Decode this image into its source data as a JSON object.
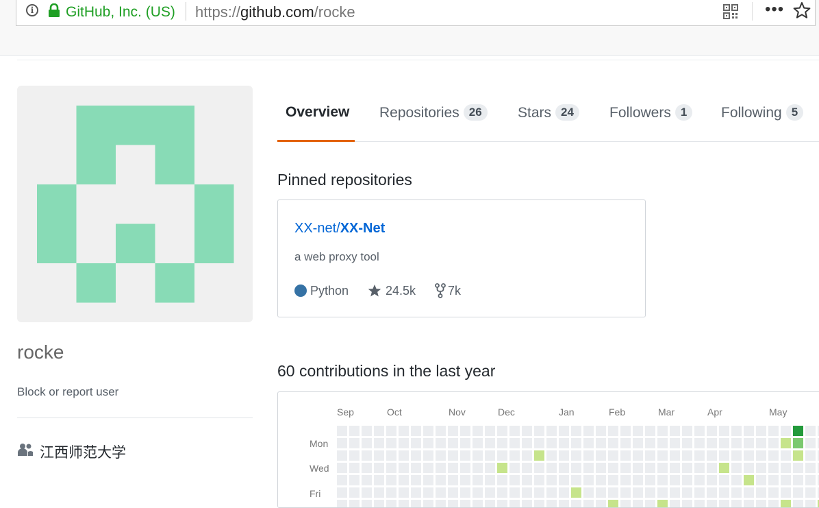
{
  "browser": {
    "site_identity": "GitHub, Inc. (US)",
    "url_prefix": "https://",
    "url_domain": "github.com",
    "url_path": "/rocke"
  },
  "profile": {
    "username": "rocke",
    "block_link": "Block or report user",
    "organization": "江西师范大学",
    "avatar_color": "#88dbb6"
  },
  "tabs": [
    {
      "label": "Overview",
      "count": ""
    },
    {
      "label": "Repositories",
      "count": "26"
    },
    {
      "label": "Stars",
      "count": "24"
    },
    {
      "label": "Followers",
      "count": "1"
    },
    {
      "label": "Following",
      "count": "5"
    }
  ],
  "pinned": {
    "title": "Pinned repositories",
    "repo_owner": "XX-net/",
    "repo_name": "XX-Net",
    "description": "a web proxy tool",
    "language": "Python",
    "language_color": "#3572a5",
    "stars": "24.5k",
    "forks": "7k"
  },
  "contributions": {
    "title": "60 contributions in the last year",
    "months": [
      "Sep",
      "Oct",
      "Nov",
      "Dec",
      "Jan",
      "Feb",
      "Mar",
      "Apr",
      "May"
    ],
    "days": [
      "Mon",
      "Wed",
      "Fri"
    ],
    "colors": {
      "empty": "#ebedf0",
      "level1": "#c6e48b",
      "level2": "#7bc96f",
      "level3": "#239a3b"
    }
  }
}
